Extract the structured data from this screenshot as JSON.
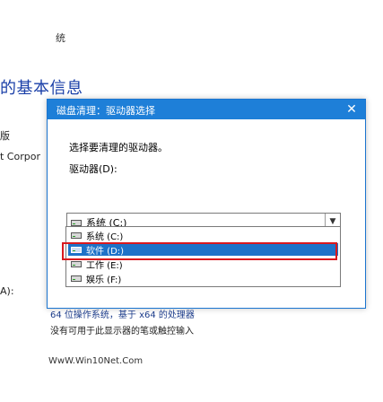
{
  "background": {
    "top_fragment": "统",
    "section_title": "的基本信息",
    "row1": "版",
    "row2": "t Corpor",
    "row3": "A):",
    "under_dialog_line1": "64 位操作系统，基于 x64 的处理器",
    "under_dialog_line2": "没有可用于此显示器的笔或触控输入"
  },
  "dialog": {
    "title": "磁盘清理：驱动器选择",
    "close_label": "✕",
    "message": "选择要清理的驱动器。",
    "drive_label": "驱动器(D):",
    "selected_drive": "系统 (C:)",
    "options": [
      {
        "label": "系统 (C:)",
        "selected": false
      },
      {
        "label": "软件 (D:)",
        "selected": true
      },
      {
        "label": "工作 (E:)",
        "selected": false
      },
      {
        "label": "娱乐 (F:)",
        "selected": false
      }
    ]
  },
  "watermark": "WwW.Win10Net.Com",
  "colors": {
    "titlebar": "#1e7fd8",
    "selection": "#1e72c8",
    "highlight_border": "#d9191e"
  }
}
